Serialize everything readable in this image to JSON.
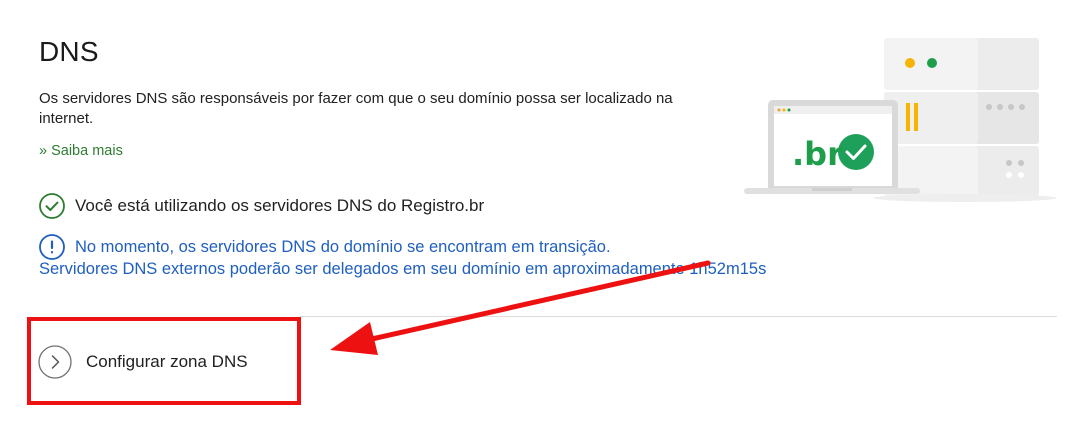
{
  "section": {
    "title": "DNS",
    "description": "Os servidores DNS são responsáveis por fazer com que o seu domínio possa ser localizado na internet.",
    "saiba_mais": "» Saiba mais"
  },
  "status": {
    "ok_text": "Você está utilizando os servidores DNS do Registro.br",
    "info_line1": "No momento, os servidores DNS do domínio se encontram em transição.",
    "info_line2": "Servidores DNS externos poderão ser delegados em seu domínio em aproximadamente 1h52m15s"
  },
  "actions": {
    "configure_label": "Configurar zona DNS"
  },
  "illustration": {
    "laptop_logo": ".br"
  },
  "colors": {
    "success_green": "#2e7d32",
    "check_badge_green": "#1ea05a",
    "info_blue": "#1f5fbf",
    "annotation_red": "#ee1111",
    "server_yellow": "#f4b400",
    "server_green": "#1e9e4a"
  },
  "icons": {
    "ok": "check-circle-icon",
    "info": "info-circle-icon",
    "configure": "chevron-right-circle-icon"
  }
}
